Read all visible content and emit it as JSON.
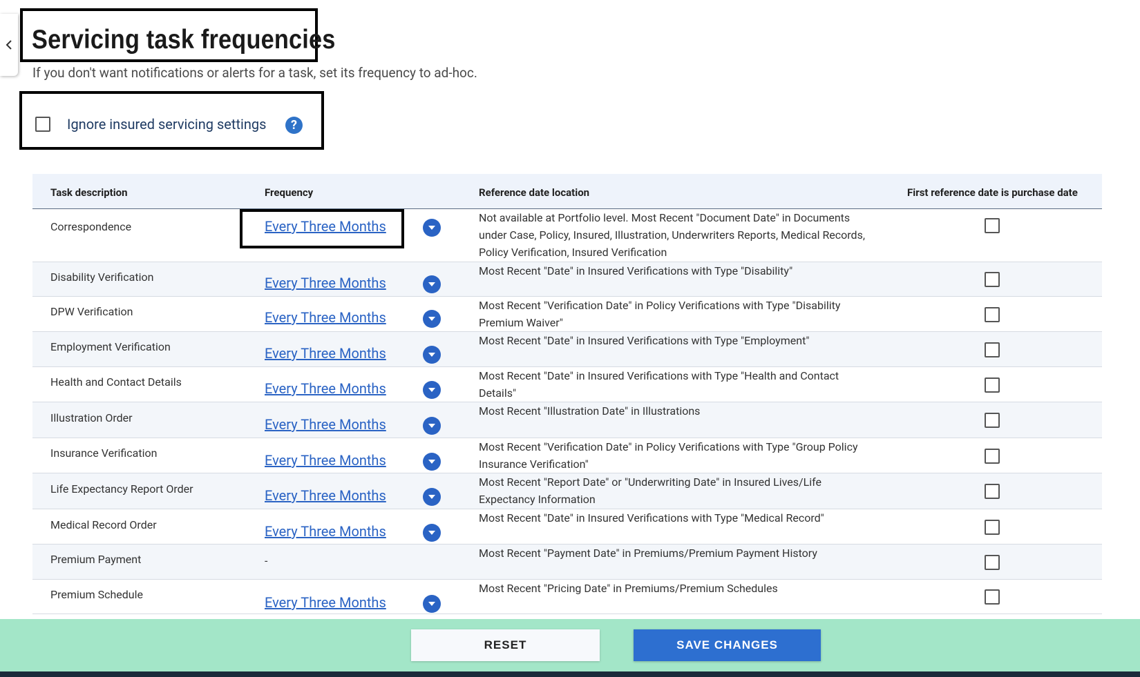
{
  "page": {
    "title": "Servicing task frequencies",
    "subtitle": "If you don't want notifications or alerts for a task, set its frequency to ad-hoc."
  },
  "ignore_setting": {
    "label": "Ignore insured servicing settings",
    "checked": false,
    "help_icon": "question-icon"
  },
  "table": {
    "headers": {
      "task": "Task description",
      "frequency": "Frequency",
      "reference": "Reference date location",
      "first_ref": "First reference date is purchase date"
    },
    "rows": [
      {
        "task": "Correspondence",
        "frequency": "Every Three Months",
        "reference": "Not available at Portfolio level. Most Recent \"Document Date\" in Documents under Case, Policy, Insured, Illustration, Underwriters Reports, Medical Records, Policy Verification, Insured Verification",
        "checked": false
      },
      {
        "task": "Disability Verification",
        "frequency": "Every Three Months",
        "reference": "Most Recent \"Date\" in Insured Verifications with Type \"Disability\"",
        "checked": false
      },
      {
        "task": "DPW Verification",
        "frequency": "Every Three Months",
        "reference": "Most Recent \"Verification Date\" in Policy Verifications with Type \"Disability Premium Waiver\"",
        "checked": false
      },
      {
        "task": "Employment Verification",
        "frequency": "Every Three Months",
        "reference": "Most Recent \"Date\" in Insured Verifications with Type \"Employment\"",
        "checked": false
      },
      {
        "task": "Health and Contact Details",
        "frequency": "Every Three Months",
        "reference": "Most Recent \"Date\" in Insured Verifications with Type \"Health and Contact Details\"",
        "checked": false
      },
      {
        "task": "Illustration Order",
        "frequency": "Every Three Months",
        "reference": "Most Recent \"Illustration Date\" in Illustrations",
        "checked": false
      },
      {
        "task": "Insurance Verification",
        "frequency": "Every Three Months",
        "reference": "Most Recent \"Verification Date\" in Policy Verifications with Type \"Group Policy Insurance Verification\"",
        "checked": false
      },
      {
        "task": "Life Expectancy Report Order",
        "frequency": "Every Three Months",
        "reference": "Most Recent \"Report Date\" or \"Underwriting Date\" in Insured Lives/Life Expectancy Information",
        "checked": false
      },
      {
        "task": "Medical Record Order",
        "frequency": "Every Three Months",
        "reference": "Most Recent \"Date\" in Insured Verifications with Type \"Medical Record\"",
        "checked": false
      },
      {
        "task": "Premium Payment",
        "frequency": "-",
        "reference": "Most Recent \"Payment Date\" in Premiums/Premium Payment History",
        "checked": false
      },
      {
        "task": "Premium Schedule",
        "frequency": "Every Three Months",
        "reference": "Most Recent \"Pricing Date\" in Premiums/Premium Schedules",
        "checked": false
      }
    ]
  },
  "footer": {
    "reset_label": "RESET",
    "save_label": "SAVE CHANGES"
  },
  "colors": {
    "accent": "#2d6fd0",
    "footer_bg": "#a3e6c8",
    "link": "#2a63c4"
  }
}
